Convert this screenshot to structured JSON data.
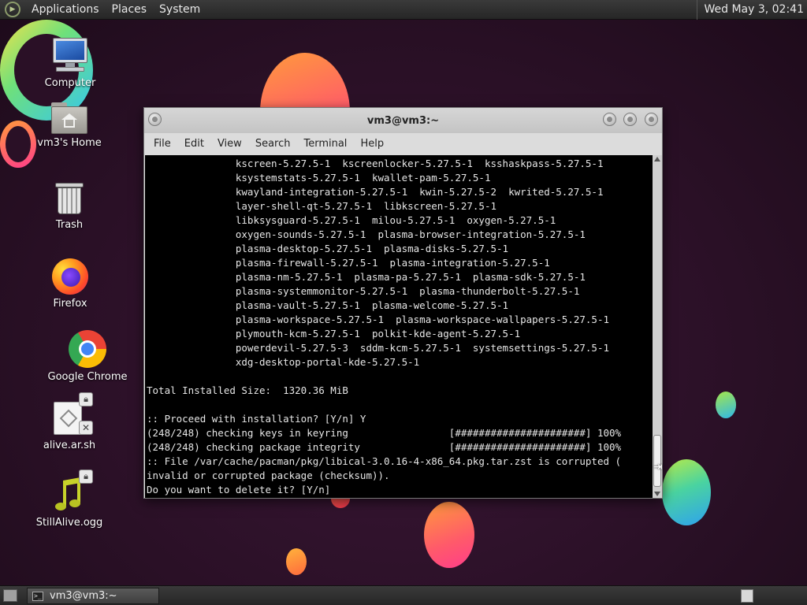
{
  "top_panel": {
    "menus": [
      "Applications",
      "Places",
      "System"
    ],
    "clock": "Wed May  3, 02:41",
    "logo_icon": "mate-logo-icon"
  },
  "desktop": {
    "icons": [
      {
        "label": "Computer",
        "icon": "computer-icon"
      },
      {
        "label": "vm3's Home",
        "icon": "home-folder-icon"
      },
      {
        "label": "Trash",
        "icon": "trash-icon"
      },
      {
        "label": "Firefox",
        "icon": "firefox-icon"
      },
      {
        "label": "Google Chrome",
        "icon": "chrome-icon"
      },
      {
        "label": "alive.ar.sh",
        "icon": "script-file-icon"
      },
      {
        "label": "StillAlive.ogg",
        "icon": "audio-file-icon"
      }
    ],
    "background_colors": {
      "base": "#2a1026",
      "orange": "#ff7a4a",
      "blue": "#2ea2ef"
    }
  },
  "terminal": {
    "title": "vm3@vm3:~",
    "menus": [
      "File",
      "Edit",
      "View",
      "Search",
      "Terminal",
      "Help"
    ],
    "lines": [
      "               kscreen-5.27.5-1  kscreenlocker-5.27.5-1  ksshaskpass-5.27.5-1",
      "               ksystemstats-5.27.5-1  kwallet-pam-5.27.5-1",
      "               kwayland-integration-5.27.5-1  kwin-5.27.5-2  kwrited-5.27.5-1",
      "               layer-shell-qt-5.27.5-1  libkscreen-5.27.5-1",
      "               libksysguard-5.27.5-1  milou-5.27.5-1  oxygen-5.27.5-1",
      "               oxygen-sounds-5.27.5-1  plasma-browser-integration-5.27.5-1",
      "               plasma-desktop-5.27.5-1  plasma-disks-5.27.5-1",
      "               plasma-firewall-5.27.5-1  plasma-integration-5.27.5-1",
      "               plasma-nm-5.27.5-1  plasma-pa-5.27.5-1  plasma-sdk-5.27.5-1",
      "               plasma-systemmonitor-5.27.5-1  plasma-thunderbolt-5.27.5-1",
      "               plasma-vault-5.27.5-1  plasma-welcome-5.27.5-1",
      "               plasma-workspace-5.27.5-1  plasma-workspace-wallpapers-5.27.5-1",
      "               plymouth-kcm-5.27.5-1  polkit-kde-agent-5.27.5-1",
      "               powerdevil-5.27.5-3  sddm-kcm-5.27.5-1  systemsettings-5.27.5-1",
      "               xdg-desktop-portal-kde-5.27.5-1",
      "",
      "Total Installed Size:  1320.36 MiB",
      "",
      ":: Proceed with installation? [Y/n] Y",
      "(248/248) checking keys in keyring                 [######################] 100%",
      "(248/248) checking package integrity               [######################] 100%",
      ":: File /var/cache/pacman/pkg/libical-3.0.16-4-x86_64.pkg.tar.zst is corrupted (",
      "invalid or corrupted package (checksum)).",
      "Do you want to delete it? [Y/n]"
    ]
  },
  "bottom_panel": {
    "task_label": "vm3@vm3:~",
    "task_icon": "terminal-icon"
  }
}
